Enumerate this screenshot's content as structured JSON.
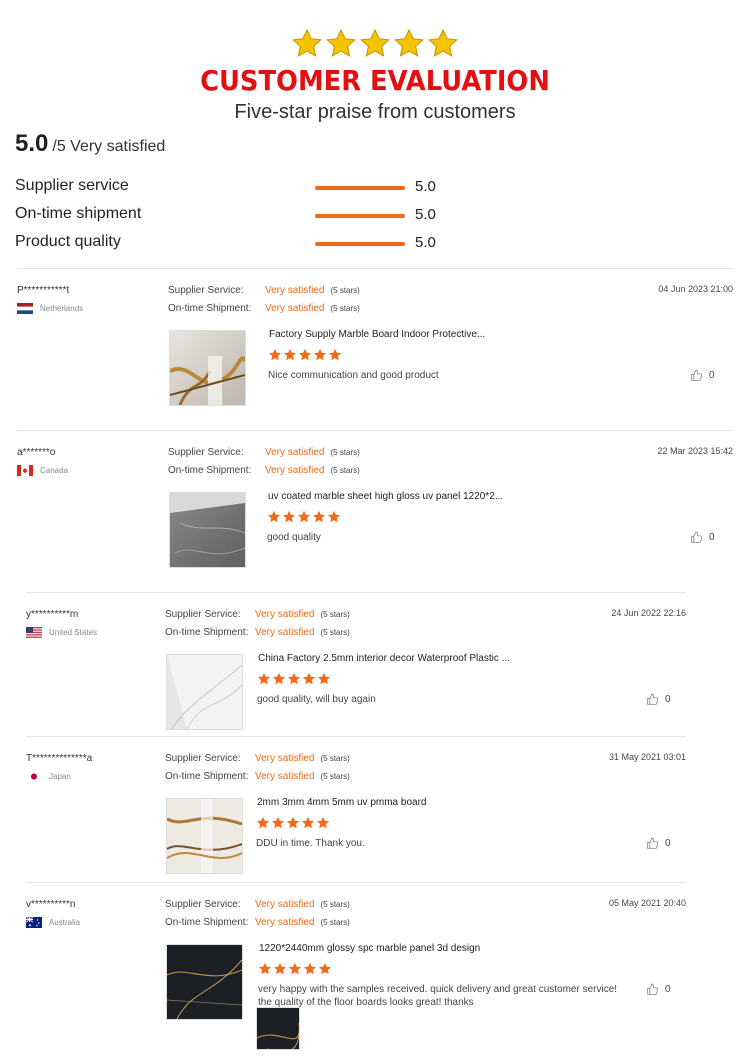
{
  "header": {
    "star_count": 5,
    "title": "CUSTOMER EVALUATION",
    "subtitle": "Five-star praise from customers",
    "star_color": "#f5c400"
  },
  "overall": {
    "score": "5.0",
    "text": "/5 Very satisfied"
  },
  "metrics": [
    {
      "label": "Supplier service",
      "value": "5.0",
      "fill": 1.0
    },
    {
      "label": "On-time shipment",
      "value": "5.0",
      "fill": 1.0
    },
    {
      "label": "Product quality",
      "value": "5.0",
      "fill": 1.0
    }
  ],
  "labels": {
    "supplier_service": "Supplier Service:",
    "ontime_shipment": "On-time Shipment:",
    "very_satisfied": "Very satisfied",
    "five_stars": "(5 stars)"
  },
  "accent": "#f06a1a",
  "reviews": [
    {
      "user": "P***********t",
      "country": "Netherlands",
      "flag": "nl",
      "date": "04 Jun 2023 21:00",
      "title": "Factory Supply Marble Board Indoor Protective...",
      "comment": "Nice communication and good product",
      "likes": "0",
      "rating": 5
    },
    {
      "user": "a*******o",
      "country": "Canada",
      "flag": "ca",
      "date": "22 Mar 2023 15:42",
      "title": "uv coated marble sheet high gloss uv panel 1220*2...",
      "comment": "good quality",
      "likes": "0",
      "rating": 5
    },
    {
      "user": "y**********m",
      "country": "United States",
      "flag": "us",
      "date": "24 Jun 2022 22:16",
      "title": "China Factory 2.5mm interior decor Waterproof Plastic ...",
      "comment": "good quality, will buy again",
      "likes": "0",
      "rating": 5
    },
    {
      "user": "T**************a",
      "country": "Japan",
      "flag": "jp",
      "date": "31 May 2021 03:01",
      "title": "2mm 3mm 4mm 5mm uv pmma board",
      "comment": "DDU in time. Thank you.",
      "likes": "0",
      "rating": 5
    },
    {
      "user": "v**********n",
      "country": "Australia",
      "flag": "au",
      "date": "05 May 2021 20:40",
      "title": "1220*2440mm glossy spc marble panel 3d design",
      "comment": "very happy with the samples received. quick delivery and great customer service!\nthe quality of the floor boards looks great! thanks",
      "likes": "0",
      "rating": 5
    }
  ]
}
